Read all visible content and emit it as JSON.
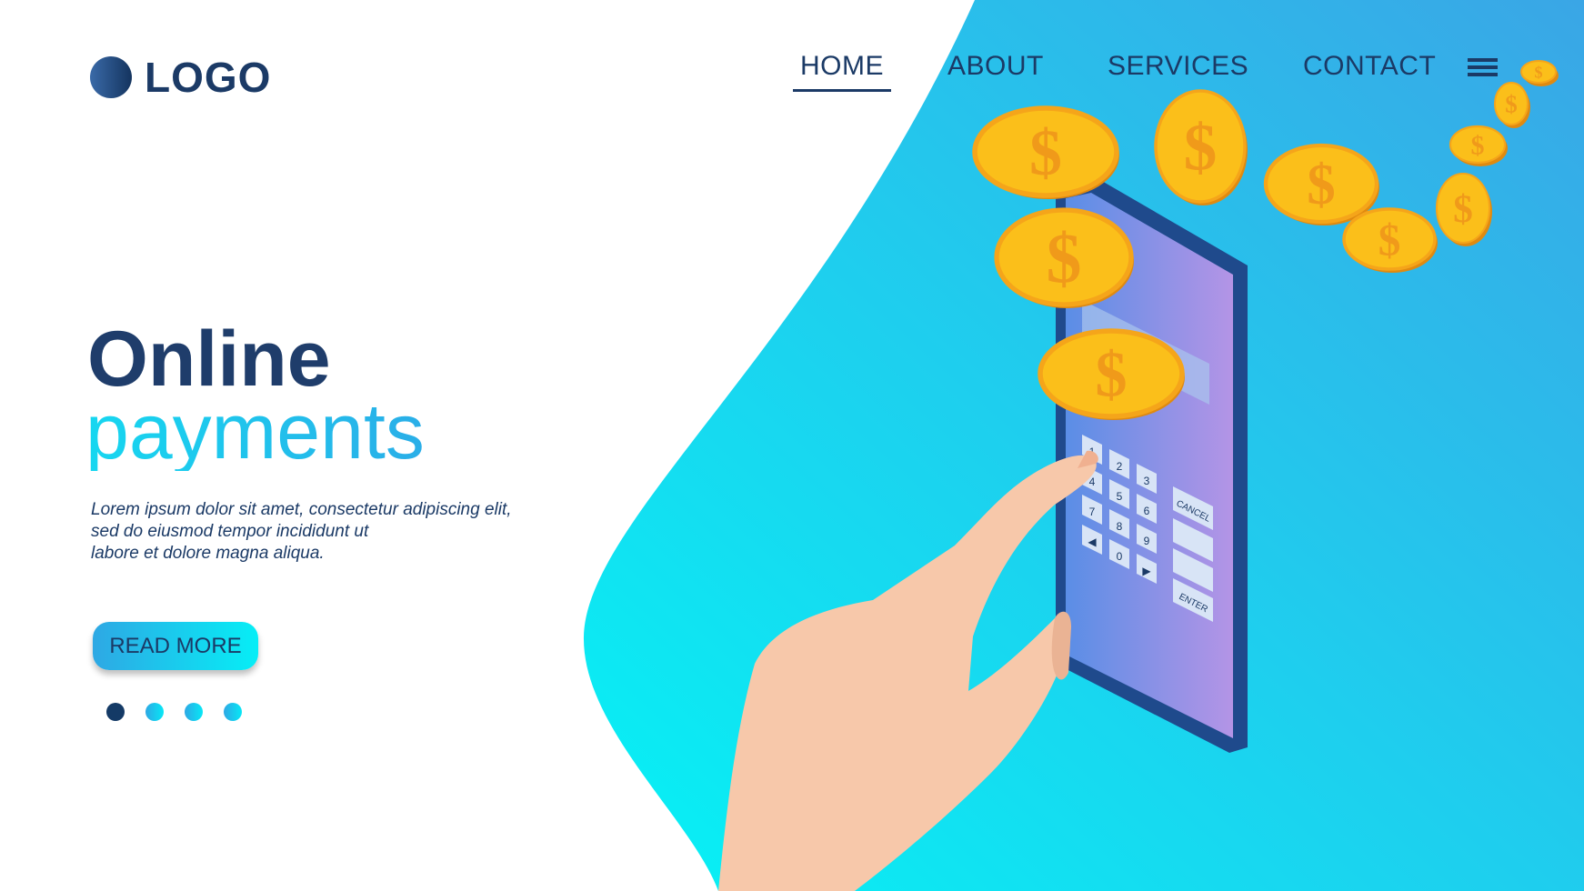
{
  "header": {
    "logo": "LOGO",
    "nav": [
      {
        "label": "HOME",
        "active": true
      },
      {
        "label": "ABOUT",
        "active": false
      },
      {
        "label": "SERVICES",
        "active": false
      },
      {
        "label": "CONTACT",
        "active": false
      }
    ],
    "menu_icon": "hamburger-icon"
  },
  "hero": {
    "title_line1": "Online",
    "title_line2": "payments",
    "paragraph": [
      "Lorem ipsum dolor sit amet, consectetur adipiscing elit,",
      "sed do eiusmod tempor incididunt ut",
      "labore et dolore magna aliqua."
    ],
    "button": "READ MORE",
    "slides": 4,
    "active_slide": 1
  },
  "illustration": {
    "coin_symbol": "$",
    "keypad": [
      "1",
      "2",
      "3",
      "4",
      "5",
      "6",
      "7",
      "8",
      "9",
      "◀",
      "0",
      "▶"
    ],
    "cancel_label": "CANCEL",
    "enter_label": "ENTER"
  },
  "colors": {
    "primary": "#1b3a66",
    "accent": "#18c8ee",
    "coin": "#fbbf1a",
    "skin": "#f7c8aa"
  }
}
